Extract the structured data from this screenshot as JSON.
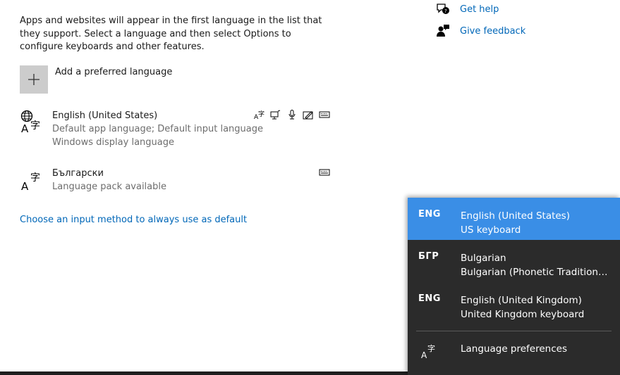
{
  "description": "Apps and websites will appear in the first language in the list that they support. Select a language and then select Options to configure keyboards and other features.",
  "add_language": {
    "label": "Add a preferred language"
  },
  "languages": [
    {
      "name": "English (United States)",
      "line1": "Default app language; Default input language",
      "line2": "Windows display language"
    },
    {
      "name": "Български",
      "line1": "Language pack available",
      "line2": ""
    }
  ],
  "input_method_link": "Choose an input method to always use as default",
  "help": {
    "get_help": "Get help",
    "give_feedback": "Give feedback"
  },
  "flyout": {
    "items": [
      {
        "code": "ENG",
        "line1": "English (United States)",
        "line2": "US keyboard",
        "selected": true
      },
      {
        "code": "БГР",
        "line1": "Bulgarian",
        "line2": "Bulgarian (Phonetic Traditional)",
        "selected": false
      },
      {
        "code": "ENG",
        "line1": "English (United Kingdom)",
        "line2": "United Kingdom keyboard",
        "selected": false
      }
    ],
    "preferences": "Language preferences"
  },
  "colors": {
    "accent": "#3a8ee6",
    "link": "#0067b8",
    "flyout_bg": "#2b2b2b"
  }
}
